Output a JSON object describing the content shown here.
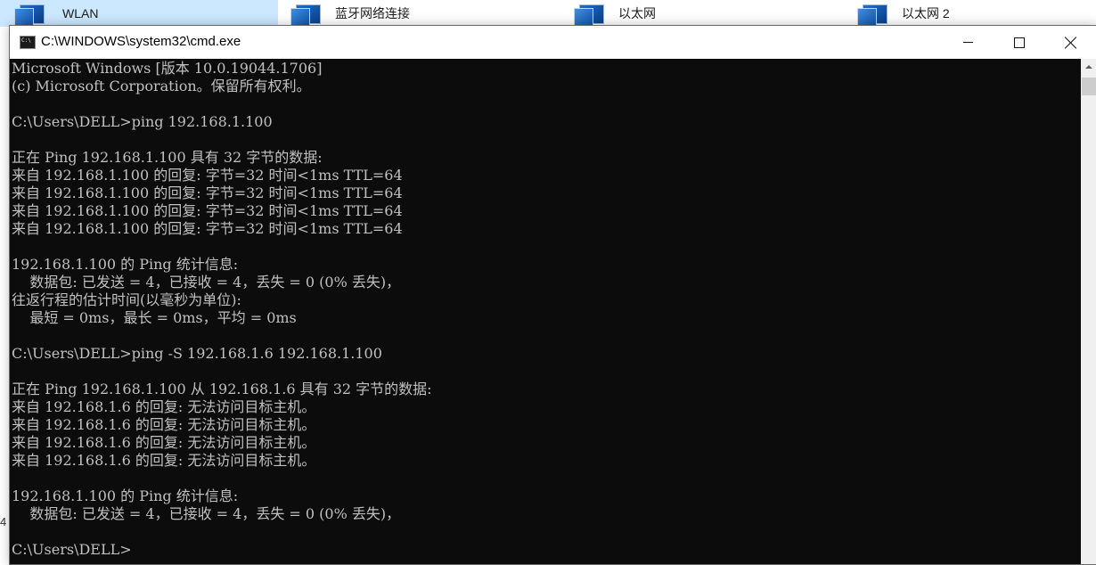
{
  "background": {
    "items": [
      {
        "label": "WLAN",
        "icon": "network-adapter-icon",
        "selected": true
      },
      {
        "label": "蓝牙网络连接",
        "icon": "network-adapter-icon",
        "selected": false
      },
      {
        "label": "以太网",
        "icon": "network-adapter-icon",
        "selected": false
      },
      {
        "label": "以太网 2",
        "icon": "network-adapter-icon",
        "selected": false
      }
    ],
    "edge_char": "4"
  },
  "window": {
    "title": "C:\\WINDOWS\\system32\\cmd.exe",
    "icon": "cmd-icon",
    "controls": {
      "minimize": "minimize-icon",
      "maximize": "maximize-icon",
      "close": "close-icon"
    }
  },
  "console": {
    "lines": [
      "Microsoft Windows [版本 10.0.19044.1706]",
      "(c) Microsoft Corporation。保留所有权利。",
      "",
      "C:\\Users\\DELL>ping 192.168.1.100",
      "",
      "正在 Ping 192.168.1.100 具有 32 字节的数据:",
      "来自 192.168.1.100 的回复: 字节=32 时间<1ms TTL=64",
      "来自 192.168.1.100 的回复: 字节=32 时间<1ms TTL=64",
      "来自 192.168.1.100 的回复: 字节=32 时间<1ms TTL=64",
      "来自 192.168.1.100 的回复: 字节=32 时间<1ms TTL=64",
      "",
      "192.168.1.100 的 Ping 统计信息:",
      "    数据包: 已发送 = 4，已接收 = 4，丢失 = 0 (0% 丢失)，",
      "往返行程的估计时间(以毫秒为单位):",
      "    最短 = 0ms，最长 = 0ms，平均 = 0ms",
      "",
      "C:\\Users\\DELL>ping -S 192.168.1.6 192.168.1.100",
      "",
      "正在 Ping 192.168.1.100 从 192.168.1.6 具有 32 字节的数据:",
      "来自 192.168.1.6 的回复: 无法访问目标主机。",
      "来自 192.168.1.6 的回复: 无法访问目标主机。",
      "来自 192.168.1.6 的回复: 无法访问目标主机。",
      "来自 192.168.1.6 的回复: 无法访问目标主机。",
      "",
      "192.168.1.100 的 Ping 统计信息:",
      "    数据包: 已发送 = 4，已接收 = 4，丢失 = 0 (0% 丢失)，",
      "",
      "C:\\Users\\DELL>"
    ],
    "text_color": "#c0c0c0",
    "background_color": "#0c0c0c"
  }
}
